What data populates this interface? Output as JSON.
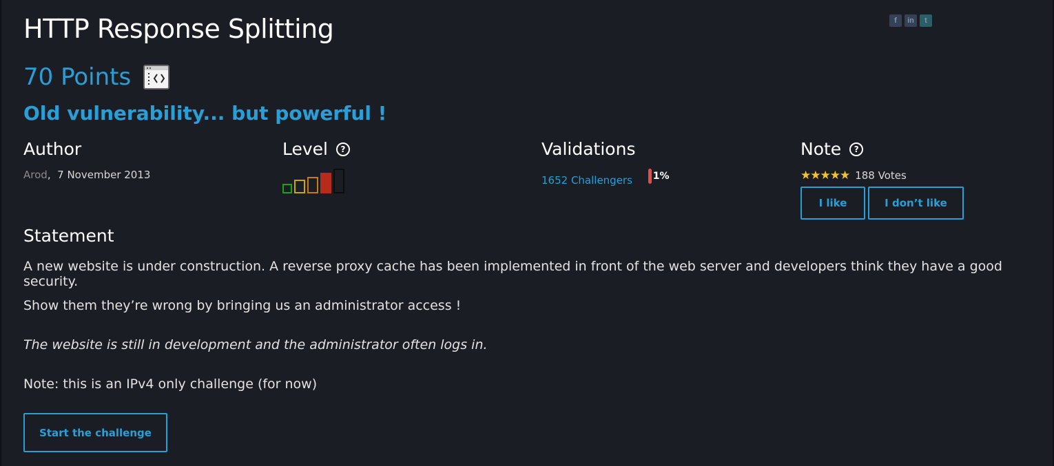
{
  "challenge": {
    "title": "HTTP Response Splitting",
    "points": "70 Points",
    "subtitle": "Old vulnerability... but powerful !"
  },
  "social": {
    "facebook": "f",
    "linkedin": "in",
    "twitter": "t"
  },
  "icons": {
    "category": "web-server-icon",
    "help": "question-circle-icon"
  },
  "author": {
    "heading": "Author",
    "name": "Arod",
    "separator": ",",
    "date": "7 November 2013"
  },
  "level": {
    "heading": "Level",
    "help_glyph": "?",
    "value": 4,
    "max": 5,
    "colors": [
      "#1aa31a",
      "#c9a800",
      "#c87a16",
      "#b82a1a",
      "#111111"
    ]
  },
  "validations": {
    "heading": "Validations",
    "challengers": "1652 Challengers",
    "percent": "1%",
    "bar_color": "#e74c4c"
  },
  "note": {
    "heading": "Note",
    "help_glyph": "?",
    "stars": "★★★★★",
    "rating": 5,
    "votes": "188 Votes",
    "like": "I like",
    "dislike": "I don’t like"
  },
  "statement": {
    "heading": "Statement",
    "p1": "A new website is under construction. A reverse proxy cache has been implemented in front of the web server and developers think they have a good security.",
    "p2": "Show them they’re wrong by bringing us an administrator access !",
    "p3": "The website is still in development and the administrator often logs in.",
    "p4": "Note: this is an IPv4 only challenge (for now)"
  },
  "actions": {
    "start": "Start the challenge"
  },
  "colors": {
    "accent": "#2a9fd6",
    "background": "#1b1d25",
    "star": "#f1c232"
  }
}
